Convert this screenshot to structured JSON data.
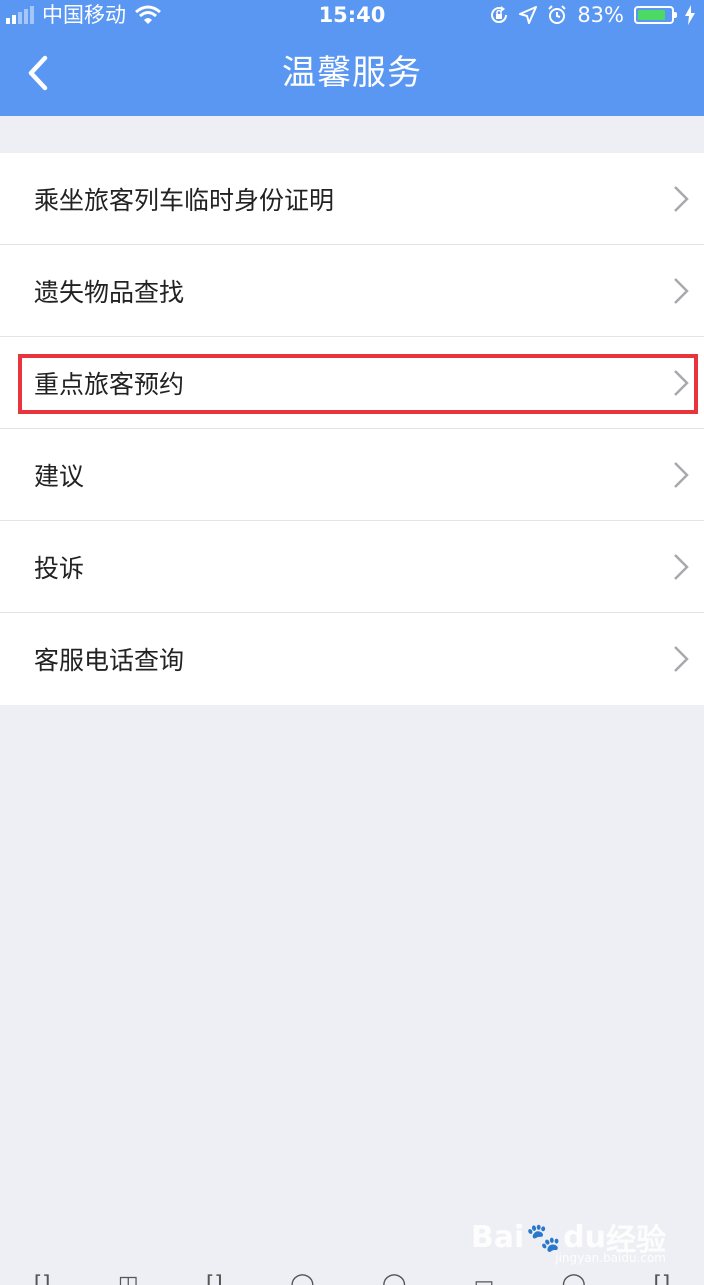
{
  "status_bar": {
    "carrier": "中国移动",
    "time": "15:40",
    "battery_percent": "83%",
    "battery_level": 0.83,
    "icons": [
      "signal-icon",
      "wifi-icon",
      "rotation-lock-icon",
      "location-icon",
      "alarm-icon",
      "battery-icon",
      "charging-icon"
    ]
  },
  "header": {
    "title": "温馨服务",
    "back_icon": "chevron-left-icon",
    "background_color": "#5a97f2"
  },
  "menu": {
    "items": [
      {
        "label": "乘坐旅客列车临时身份证明"
      },
      {
        "label": "遗失物品查找"
      },
      {
        "label": "重点旅客预约"
      },
      {
        "label": "建议"
      },
      {
        "label": "投诉"
      },
      {
        "label": "客服电话查询"
      }
    ],
    "highlighted_index": 2,
    "highlight_color": "#e8343c"
  },
  "watermark": {
    "brand": "Bai",
    "brand_suffix": "du",
    "product": "经验",
    "url": "jingyan.baidu.com"
  }
}
